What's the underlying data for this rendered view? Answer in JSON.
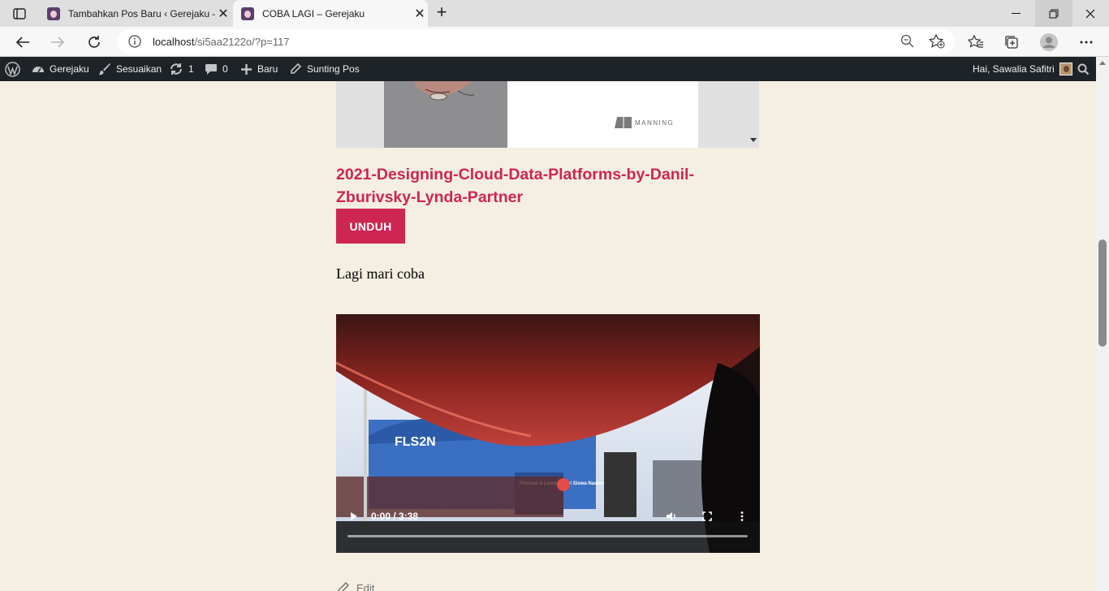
{
  "browser": {
    "tabs": [
      {
        "title": "Tambahkan Pos Baru ‹ Gerejaku —",
        "active": false
      },
      {
        "title": "COBA LAGI – Gerejaku",
        "active": true
      }
    ],
    "address": {
      "host": "localhost",
      "path": "/si5aa2122o/?p=117"
    }
  },
  "adminbar": {
    "site": "Gerejaku",
    "customize": "Sesuaikan",
    "updates": "1",
    "comments": "0",
    "new": "Baru",
    "edit_post": "Sunting Pos",
    "greeting": "Hai, Sawalia Safitri"
  },
  "post": {
    "pdf_publisher": "MANNING",
    "file_title": "2021-Designing-Cloud-Data-Platforms-by-Danil-Zburivsky-Lynda-Partner",
    "download_label": "UNDUH",
    "paragraph": "Lagi mari coba",
    "video": {
      "time": "0:00 / 3:38",
      "progress": 0,
      "banner_text": "Festival & Lomba Seni Siswa Nasional",
      "logo_text": "FLS2N"
    },
    "edit_label": "Edit"
  },
  "colors": {
    "accent": "#cd2653",
    "background": "#f4efe1",
    "adminbar": "#1d2327"
  }
}
